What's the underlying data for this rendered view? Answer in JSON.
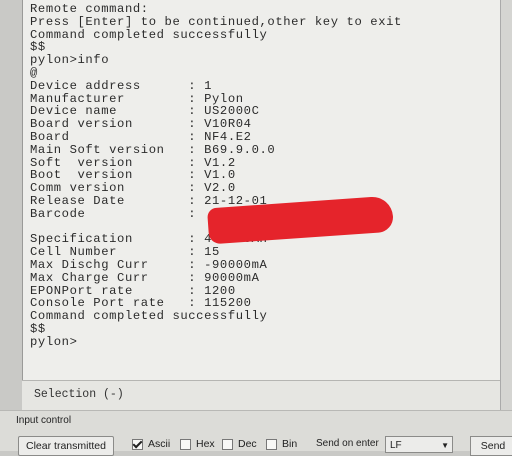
{
  "terminal": {
    "lines": [
      "Remote command:",
      "Press [Enter] to be continued,other key to exit",
      "Command completed successfully",
      "$$",
      "pylon>info",
      "@",
      "Device address      : 1",
      "Manufacturer        : Pylon",
      "Device name         : US2000C",
      "Board version       : V10R04",
      "Board               : NF4.E2",
      "Main Soft version   : B69.9.0.0",
      "Soft  version       : V1.2",
      "Boot  version       : V1.0",
      "Comm version        : V2.0",
      "Release Date        : 21-12-01",
      "Barcode             :",
      "",
      "Specification       : 48V/50AH",
      "Cell Number         : 15",
      "Max Dischg Curr     : -90000mA",
      "Max Charge Curr     : 90000mA",
      "EPONPort rate       : 1200",
      "Console Port rate   : 115200",
      "Command completed successfully",
      "$$",
      "pylon>"
    ]
  },
  "selection": {
    "label": "Selection (-)"
  },
  "input_control": {
    "title": "Input control",
    "clear_button": "Clear transmitted",
    "options": [
      {
        "label": "Ascii",
        "checked": true
      },
      {
        "label": "Hex",
        "checked": false
      },
      {
        "label": "Dec",
        "checked": false
      },
      {
        "label": "Bin",
        "checked": false
      }
    ],
    "send_on_enter_label": "Send on enter",
    "send_on_enter_value": "LF",
    "send_button": "Send"
  },
  "colors": {
    "redaction": "#e5242b",
    "background": "#eeeeeb"
  }
}
